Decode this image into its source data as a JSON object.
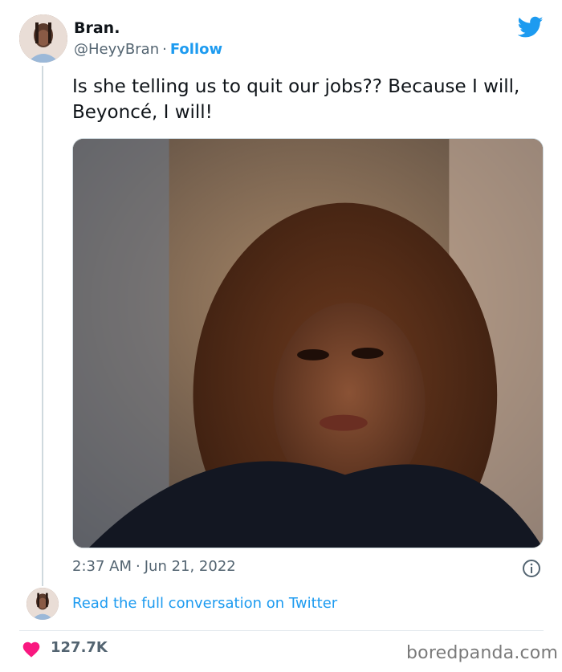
{
  "author": {
    "name": "Bran.",
    "handle": "@HeyyBran",
    "separator": "·",
    "follow_label": "Follow"
  },
  "tweet": {
    "text": "Is she telling us to quit our jobs?? Because I will, Beyoncé, I will!",
    "time": "2:37 AM",
    "date_separator": "·",
    "date": "Jun 21, 2022"
  },
  "conversation": {
    "link_label": "Read the full conversation on Twitter"
  },
  "engagement": {
    "likes": "127.7K"
  },
  "watermark": {
    "text": "boredpanda.com"
  },
  "icons": {
    "brand": "twitter-bird-icon",
    "info": "info-icon",
    "like": "heart-icon"
  },
  "colors": {
    "accent": "#1d9bf0",
    "heart": "#f91880",
    "muted": "#536471"
  }
}
